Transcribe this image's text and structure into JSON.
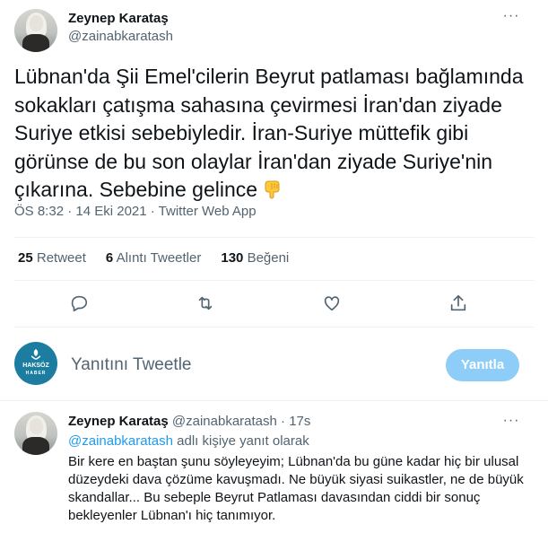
{
  "tweet": {
    "author_name": "Zeynep Karataş",
    "author_handle": "@zainabkaratash",
    "text": "Lübnan'da Şii Emel'cilerin  Beyrut patlaması bağlamında sokakları çatışma sahasına çevirmesi İran'dan ziyade Suriye etkisi sebebiyledir. İran-Suriye müttefik gibi görünse de bu son olaylar İran'dan ziyade Suriye'nin çıkarına. Sebebine gelince",
    "emoji": "backhand-index-pointing-down-icon",
    "timestamp": "ÖS 8:32 · 14 Eki 2021 · Twitter Web App",
    "stats": {
      "retweets_count": "25",
      "retweets_label": "Retweet",
      "quotes_count": "6",
      "quotes_label": "Alıntı Tweetler",
      "likes_count": "130",
      "likes_label": "Beğeni"
    }
  },
  "composer": {
    "logo_text_top": "HAKSÖZ",
    "logo_text_bottom": "HABER",
    "placeholder": "Yanıtını Tweetle",
    "button_label": "Yanıtla"
  },
  "reply": {
    "author_name": "Zeynep Karataş",
    "author_handle": "@zainabkaratash",
    "separator": "·",
    "time": "17s",
    "replying_to_handle": "@zainabkaratash",
    "replying_to_suffix": "adlı kişiye yanıt olarak",
    "text": "Bir kere en baştan şunu söyleyeyim; Lübnan'da bu güne kadar hiç bir ulusal düzeydeki dava çözüme kavuşmadı. Ne büyük siyasi suikastler, ne de büyük skandallar... Bu sebeple Beyrut Patlaması davasından ciddi bir sonuç bekleyenler Lübnan'ı hiç tanımıyor."
  },
  "colors": {
    "accent": "#1d9bf0",
    "button_disabled": "#8ecdf7",
    "secondary_text": "#536471",
    "logo_bg": "#1c7da0"
  }
}
